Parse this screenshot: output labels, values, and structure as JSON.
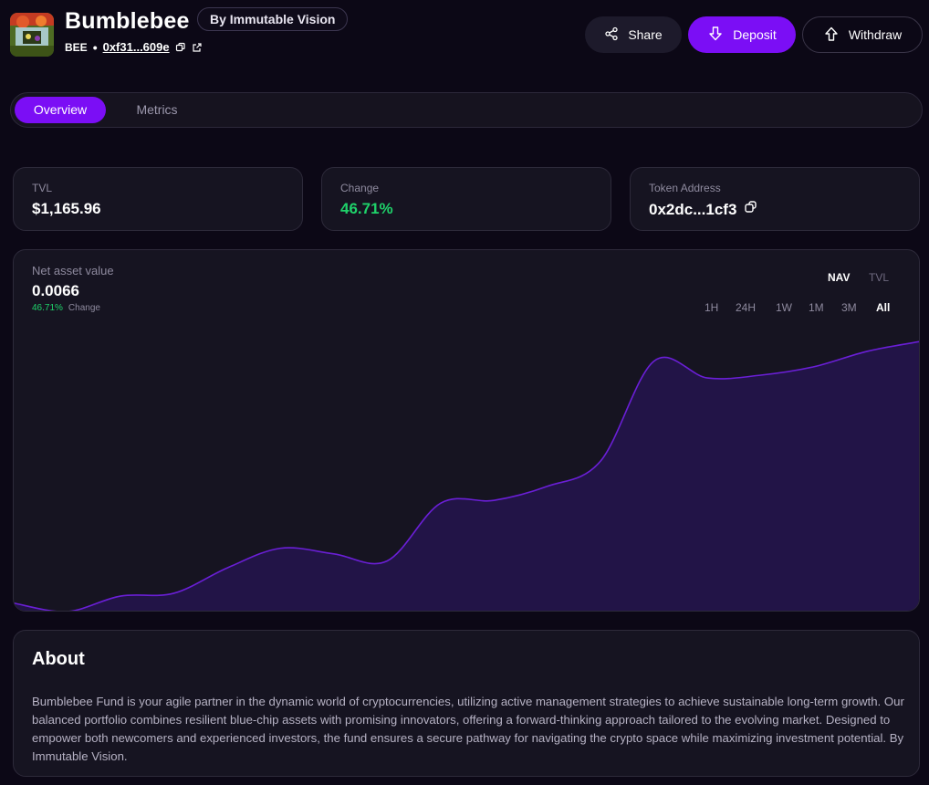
{
  "header": {
    "title": "Bumblebee",
    "creator": "By Immutable Vision",
    "ticker": "BEE",
    "address": "0xf31...609e"
  },
  "actions": {
    "share": "Share",
    "deposit": "Deposit",
    "withdraw": "Withdraw"
  },
  "tabs": [
    {
      "label": "Overview",
      "active": true
    },
    {
      "label": "Metrics",
      "active": false
    }
  ],
  "stats": {
    "tvl": {
      "label": "TVL",
      "value": "$1,165.96"
    },
    "change": {
      "label": "Change",
      "value": "46.71%"
    },
    "token_address": {
      "label": "Token Address",
      "value": "0x2dc...1cf3"
    }
  },
  "chart": {
    "label": "Net asset value",
    "value": "0.0066",
    "change_value": "46.71%",
    "change_label": "Change",
    "metric_options": [
      "NAV",
      "TVL"
    ],
    "active_metric": "NAV",
    "ranges": [
      "1H",
      "24H",
      "1W",
      "1M",
      "3M",
      "All"
    ],
    "active_range": "All"
  },
  "chart_data": {
    "type": "area",
    "series": [
      {
        "values": [
          0.3,
          0.0,
          0.55,
          0.65,
          1.55,
          2.25,
          2.05,
          1.8,
          3.85,
          3.95,
          4.45,
          5.35,
          8.9,
          8.3,
          8.4,
          8.7,
          9.25,
          9.6
        ]
      }
    ],
    "color": "#6a1fd6",
    "fill": "#221447"
  },
  "about": {
    "title": "About",
    "text": "Bumblebee Fund is your agile partner in the dynamic world of cryptocurrencies, utilizing active management strategies to achieve sustainable long-term growth. Our balanced portfolio combines resilient blue-chip assets with promising innovators, offering a forward-thinking approach tailored to the evolving market. Designed to empower both newcomers and experienced investors, the fund ensures a secure pathway for navigating the crypto space while maximizing investment potential. By Immutable Vision."
  },
  "colors": {
    "accent": "#7b0ef5",
    "positive": "#1fd26a",
    "background": "#0c0816",
    "card": "#161421"
  }
}
